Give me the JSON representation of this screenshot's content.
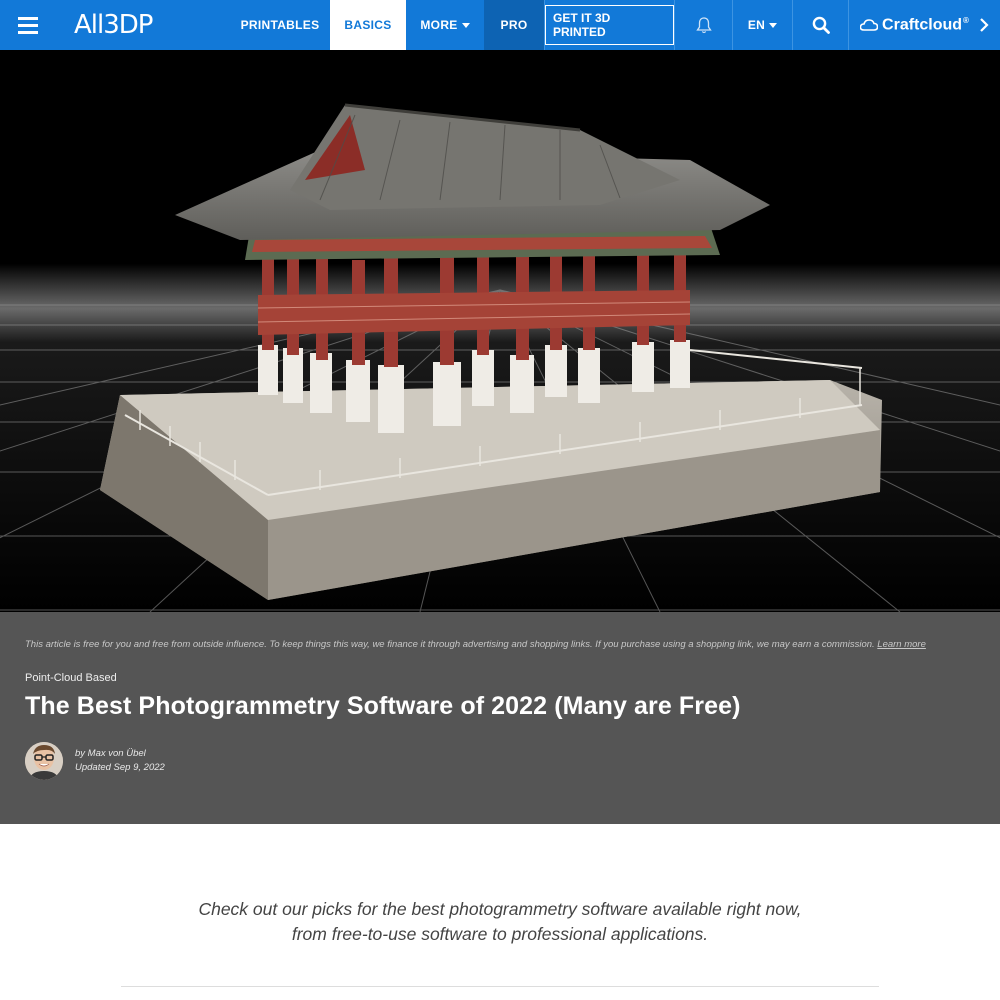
{
  "nav": {
    "logo": "All3DP",
    "items": {
      "printables": "PRINTABLES",
      "basics": "BASICS",
      "more": "MORE",
      "pro": "PRO"
    },
    "cta": "GET IT 3D PRINTED",
    "lang": "EN",
    "craftcloud": "Craftcloud",
    "craftcloud_mark": "®"
  },
  "article": {
    "disclaimer": "This article is free for you and free from outside influence. To keep things this way, we finance it through advertising and shopping links. If you purchase using a shopping link, we may earn a commission.",
    "learn_more": "Learn more",
    "category": "Point-Cloud Based",
    "title": "The Best Photogrammetry Software of 2022 (Many are Free)",
    "author": "by Max von Übel",
    "updated": "Updated Sep 9, 2022"
  },
  "intro": {
    "line1": "Check out our picks for the best photogrammetry software available right now,",
    "line2": "from free-to-use software to professional applications."
  },
  "colors": {
    "brand_blue": "#1279d8",
    "pro_blue": "#0d63b3",
    "header_gray": "#555555"
  },
  "icons": [
    "menu-icon",
    "caret-down-icon",
    "bell-icon",
    "search-icon",
    "craftcloud-logo-icon",
    "chevron-right-icon"
  ]
}
